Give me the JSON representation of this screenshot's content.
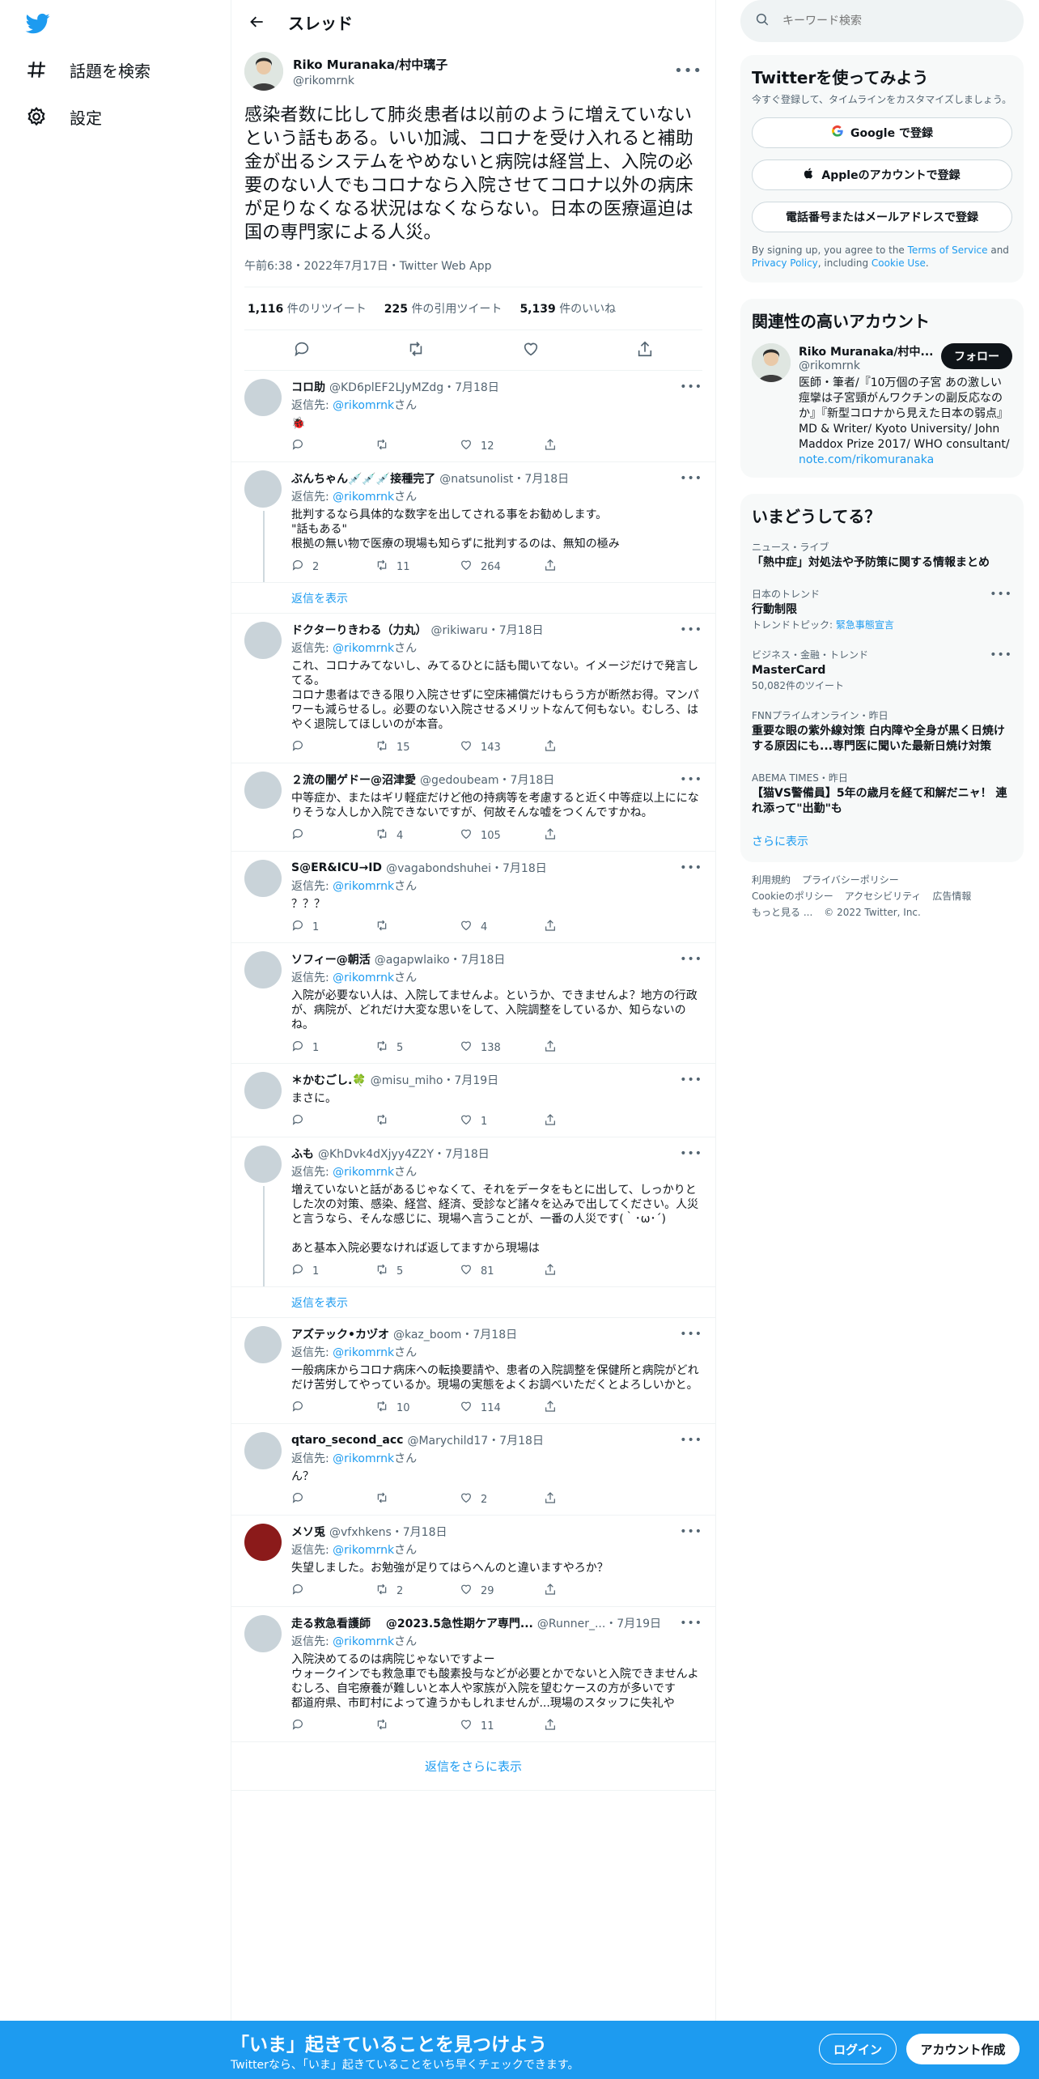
{
  "nav": {
    "explore": "話題を検索",
    "settings": "設定"
  },
  "header": {
    "title": "スレッド"
  },
  "main_tweet": {
    "name": "Riko Muranaka/村中璃子",
    "handle": "@rikomrnk",
    "text": "感染者数に比して肺炎患者は以前のように増えていないという話もある。いい加減、コロナを受け入れると補助金が出るシステムをやめないと病院は経営上、入院の必要のない人でもコロナなら入院させてコロナ以外の病床が足りなくなる状況はなくならない。日本の医療逼迫は国の専門家による人災。",
    "meta": "午前6:38・2022年7月17日・Twitter Web App",
    "retweets_num": "1,116",
    "retweets_label": "件のリツイート",
    "quotes_num": "225",
    "quotes_label": "件の引用ツイート",
    "likes_num": "5,139",
    "likes_label": "件のいいね"
  },
  "replies": [
    {
      "name": "コロ助",
      "sub": "@KD6plEF2LJyMZdg・7月18日",
      "to_prefix": "返信先: ",
      "to": "@rikomrnk",
      "to_suffix": "さん",
      "text": "🐞",
      "reply": "",
      "rt": "",
      "like": "12",
      "avatar_color": "#c9d3d9"
    },
    {
      "name": "ぶんちゃん💉💉💉接種完了",
      "sub": "@natsunolist・7月18日",
      "to_prefix": "返信先: ",
      "to": "@rikomrnk",
      "to_suffix": "さん",
      "text": "批判するなら具体的な数字を出してされる事をお勧めします。\n\"話もある\"\n根拠の無い物で医療の現場も知らずに批判するのは、無知の極み",
      "reply": "2",
      "rt": "11",
      "like": "264",
      "show_replies": "返信を表示",
      "avatar_color": "#c9d3d9"
    },
    {
      "name": "ドクターりきわる（力丸）",
      "sub": "@rikiwaru・7月18日",
      "to_prefix": "返信先: ",
      "to": "@rikomrnk",
      "to_suffix": "さん",
      "text": "これ、コロナみてないし、みてるひとに話も聞いてない。イメージだけで発言してる。\nコロナ患者はできる限り入院させずに空床補償だけもらう方が断然お得。マンパワーも減らせるし。必要のない入院させるメリットなんて何もない。むしろ、はやく退院してほしいのが本音。",
      "reply": "",
      "rt": "15",
      "like": "143",
      "avatar_color": "#c9d3d9"
    },
    {
      "name": "２流の闇ゲドー@沼津愛",
      "sub": "@gedoubeam・7月18日",
      "to_prefix": "",
      "to": "",
      "to_suffix": "",
      "text": "中等症か、またはギリ軽症だけど他の持病等を考慮すると近く中等症以上にになりそうな人しか入院できないですが、何故そんな嘘をつくんですかね。",
      "reply": "",
      "rt": "4",
      "like": "105",
      "avatar_color": "#c9d3d9"
    },
    {
      "name": "S@ER&ICU→ID",
      "sub": "@vagabondshuhei・7月18日",
      "to_prefix": "返信先: ",
      "to": "@rikomrnk",
      "to_suffix": "さん",
      "text": "？？？",
      "reply": "1",
      "rt": "",
      "like": "4",
      "avatar_color": "#c9d3d9"
    },
    {
      "name": "ソフィー@朝活",
      "sub": "@agapwlaiko・7月18日",
      "to_prefix": "返信先: ",
      "to": "@rikomrnk",
      "to_suffix": "さん",
      "text": "入院が必要ない人は、入院してませんよ。というか、できませんよ？地方の行政が、病院が、どれだけ大変な思いをして、入院調整をしているか、知らないのね。",
      "reply": "1",
      "rt": "5",
      "like": "138",
      "avatar_color": "#c9d3d9"
    },
    {
      "name": "＊かむごし.🍀",
      "sub": "@misu_miho・7月19日",
      "to_prefix": "",
      "to": "",
      "to_suffix": "",
      "text": "まさに。",
      "reply": "",
      "rt": "",
      "like": "1",
      "avatar_color": "#c9d3d9"
    },
    {
      "name": "ふも",
      "sub": "@KhDvk4dXjyy4Z2Y・7月18日",
      "to_prefix": "返信先: ",
      "to": "@rikomrnk",
      "to_suffix": "さん",
      "text": "増えていないと話があるじゃなくて、それをデータをもとに出して、しっかりとした次の対策、感染、経営、経済、受診など諸々を込みで出してください。人災と言うなら、そんな感じに、現場へ言うことが、一番の人災です(｀･ω･´)\n\nあと基本入院必要なければ返してますから現場は",
      "reply": "1",
      "rt": "5",
      "like": "81",
      "show_replies": "返信を表示",
      "avatar_color": "#c9d3d9"
    },
    {
      "name": "アズテック•カヅオ",
      "sub": "@kaz_boom・7月18日",
      "to_prefix": "返信先: ",
      "to": "@rikomrnk",
      "to_suffix": "さん",
      "text": "一般病床からコロナ病床への転換要請や、患者の入院調整を保健所と病院がどれだけ苦労してやっているか。現場の実態をよくお調べいただくとよろしいかと。",
      "reply": "",
      "rt": "10",
      "like": "114",
      "avatar_color": "#c9d3d9"
    },
    {
      "name": "qtaro_second_acc",
      "sub": "@Marychild17・7月18日",
      "to_prefix": "返信先: ",
      "to": "@rikomrnk",
      "to_suffix": "さん",
      "text": "ん？",
      "reply": "",
      "rt": "",
      "like": "2",
      "avatar_color": "#c9d3d9"
    },
    {
      "name": "メソ兎",
      "sub": "@vfxhkens・7月18日",
      "to_prefix": "返信先: ",
      "to": "@rikomrnk",
      "to_suffix": "さん",
      "text": "失望しました。お勉強が足りてはらへんのと違いますやろか？",
      "reply": "",
      "rt": "2",
      "like": "29",
      "avatar_color": "#8b1a1a"
    },
    {
      "name": "走る救急看護師　 @2023.5急性期ケア専門...",
      "sub": "@Runner_...・7月19日",
      "to_prefix": "返信先: ",
      "to": "@rikomrnk",
      "to_suffix": "さん",
      "text": "入院決めてるのは病院じゃないですよー\nウォークインでも救急車でも酸素投与などが必要とかでないと入院できませんよ\nむしろ、自宅療養が難しいと本人や家族が入院を望むケースの方が多いです\n都道府県、市町村によって違うかもしれませんが...現場のスタッフに失礼や",
      "reply": "",
      "rt": "",
      "like": "11",
      "avatar_color": "#c9d3d9"
    }
  ],
  "show_more_replies": "返信をさらに表示",
  "sidebar": {
    "search_placeholder": "キーワード検索",
    "signup": {
      "title": "Twitterを使ってみよう",
      "sub": "今すぐ登録して、タイムラインをカスタマイズしましょう。",
      "google": "Google で登録",
      "apple": "Appleのアカウントで登録",
      "phone": "電話番号またはメールアドレスで登録",
      "terms_pre": "By signing up, you agree to the ",
      "terms_link": "Terms of Service",
      "terms_and": " and ",
      "privacy_link": "Privacy Policy",
      "terms_including": ", including ",
      "cookie_link": "Cookie Use",
      "terms_end": "."
    },
    "relevant": {
      "title": "関連性の高いアカウント",
      "name": "Riko Muranaka/村中...",
      "handle": "@rikomrnk",
      "follow": "フォロー",
      "bio": "医師・筆者/『10万個の子宮 あの激しい痙攣は子宮頸がんワクチンの副反応なのか』『新型コロナから見えた日本の弱点』MD & Writer/ Kyoto University/ John Maddox Prize 2017/ WHO consultant/",
      "link": "note.com/rikomuranaka"
    },
    "trends": {
      "title": "いまどうしてる？",
      "items": [
        {
          "ctx": "ニュース・ライブ",
          "title": "「熱中症」対処法や予防策に関する情報まとめ"
        },
        {
          "ctx": "日本のトレンド",
          "title": "行動制限",
          "extra_pre": "トレンドトピック: ",
          "extra_link": "緊急事態宣言"
        },
        {
          "ctx": "ビジネス・金融・トレンド",
          "title": "MasterCard",
          "extra_pre": "50,082件のツイート",
          "extra_link": ""
        },
        {
          "ctx": "FNNプライムオンライン・昨日",
          "title": "重要な眼の紫外線対策 白内障や全身が黒く日焼けする原因にも...専門医に聞いた最新日焼け対策"
        },
        {
          "ctx": "ABEMA TIMES・昨日",
          "title": "【猫VS警備員】5年の歳月を経て和解だニャ！ 連れ添って\"出勤\"も"
        }
      ],
      "more": "さらに表示"
    },
    "footer": {
      "l1a": "利用規約",
      "l1b": "プライバシーポリシー",
      "l2a": "Cookieのポリシー",
      "l2b": "アクセシビリティ",
      "l2c": "広告情報",
      "l3a": "もっと見る ...",
      "l3b": "© 2022 Twitter, Inc."
    }
  },
  "bottombar": {
    "title": "「いま」起きていることを見つけよう",
    "sub": "Twitterなら、「いま」起きていることをいち早くチェックできます。",
    "login": "ログイン",
    "signup": "アカウント作成"
  },
  "colors": {
    "accent": "#1d9bf0",
    "text": "#0f1419",
    "muted": "#536471"
  }
}
